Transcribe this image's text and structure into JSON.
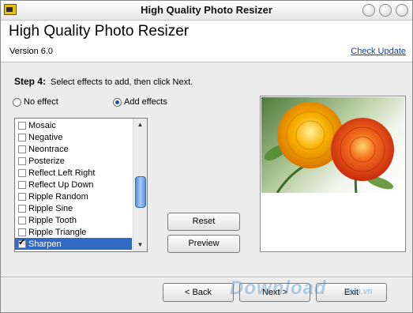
{
  "window": {
    "title": "High Quality Photo Resizer"
  },
  "header": {
    "app_title": "High Quality Photo Resizer",
    "version": "Version 6.0",
    "check_update": "Check Update"
  },
  "step": {
    "label": "Step 4:",
    "instruction": "Select effects to add, then click Next."
  },
  "options": {
    "no_effect": "No effect",
    "add_effects": "Add effects",
    "selected": "add_effects"
  },
  "effects": [
    {
      "label": "Mosaic",
      "checked": false
    },
    {
      "label": "Negative",
      "checked": false
    },
    {
      "label": "Neontrace",
      "checked": false
    },
    {
      "label": "Posterize",
      "checked": false
    },
    {
      "label": "Reflect Left Right",
      "checked": false
    },
    {
      "label": "Reflect Up Down",
      "checked": false
    },
    {
      "label": "Ripple Random",
      "checked": false
    },
    {
      "label": "Ripple Sine",
      "checked": false
    },
    {
      "label": "Ripple Tooth",
      "checked": false
    },
    {
      "label": "Ripple Triangle",
      "checked": false
    },
    {
      "label": "Sharpen",
      "checked": true,
      "selected": true
    }
  ],
  "buttons": {
    "reset": "Reset",
    "preview": "Preview",
    "back": "< Back",
    "next": "Next >",
    "exit": "Exit"
  },
  "watermark": {
    "brand": "Download",
    "domain": ".com.vn"
  },
  "colors": {
    "selection": "#3169c6",
    "link": "#0645ad",
    "flower_orange": "#f08a00",
    "flower_red": "#e8481a"
  }
}
